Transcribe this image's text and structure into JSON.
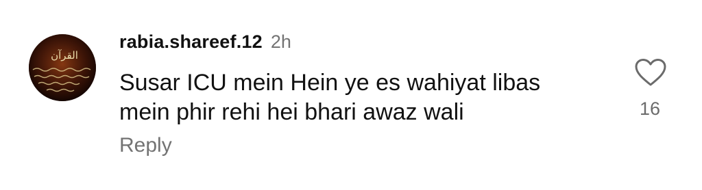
{
  "comment": {
    "username": "rabia.shareef.12",
    "timestamp": "2h",
    "text_line1": "Susar ICU mein Hein ye es wahiyat libas",
    "text_line2": "mein phir rehi hei bhari awaz wali",
    "reply_label": "Reply",
    "like_count": "16",
    "like_icon": "heart-outline-icon",
    "avatar_text": "القرآن"
  },
  "colors": {
    "username": "#111111",
    "muted": "#737373",
    "icon_stroke": "#6b6b6b",
    "avatar_bg": "#3a1408",
    "avatar_text": "#e8d9a8"
  }
}
